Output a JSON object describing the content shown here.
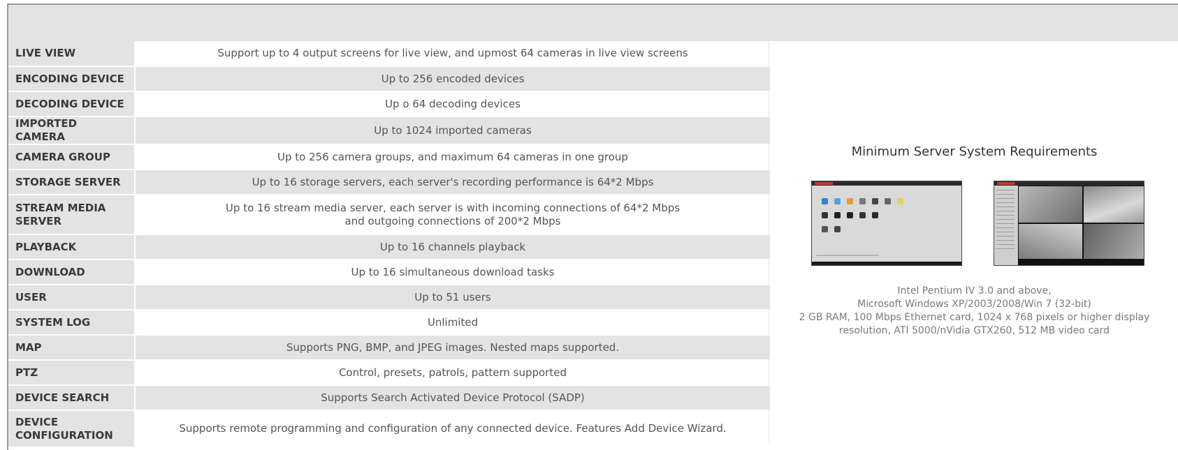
{
  "specs": [
    {
      "label": "LIVE VIEW",
      "value": "Support up to 4 output screens for live view, and upmost 64 cameras in live view screens"
    },
    {
      "label": "ENCODING DEVICE",
      "value": "Up to 256 encoded devices"
    },
    {
      "label": "DECODING DEVICE",
      "value": "Up o 64 decoding devices"
    },
    {
      "label": "IMPORTED CAMERA",
      "value": "Up to 1024 imported cameras"
    },
    {
      "label": "CAMERA GROUP",
      "value": "Up to 256 camera groups, and maximum 64 cameras in one group"
    },
    {
      "label": "STORAGE SERVER",
      "value": "Up to 16 storage servers, each server's recording performance is 64*2 Mbps"
    },
    {
      "label": "STREAM MEDIA SERVER",
      "value_line1": "Up to 16 stream media server, each server is with incoming connections of 64*2 Mbps",
      "value_line2": "and outgoing connections of 200*2 Mbps"
    },
    {
      "label": "PLAYBACK",
      "value": "Up to 16 channels playback"
    },
    {
      "label": "DOWNLOAD",
      "value": "Up to 16 simultaneous download tasks"
    },
    {
      "label": "USER",
      "value": "Up to 51 users"
    },
    {
      "label": "SYSTEM LOG",
      "value": "Unlimited"
    },
    {
      "label": "MAP",
      "value": "Supports PNG, BMP, and JPEG images. Nested maps supported."
    },
    {
      "label": "PTZ",
      "value": "Control, presets, patrols, pattern supported"
    },
    {
      "label": "DEVICE SEARCH",
      "value": "Supports Search Activated Device Protocol (SADP)"
    },
    {
      "label": "DEVICE CONFIGURATION",
      "value": "Supports remote programming and configuration of any connected device. Features Add Device Wizard."
    }
  ],
  "requirements": {
    "title": "Minimum Server System Requirements",
    "lines": [
      "Intel Pentium IV 3.0 and above,",
      "Microsoft Windows XP/2003/2008/Win 7 (32-bit)",
      "2 GB RAM, 100 Mbps Ethernet card, 1024 x 768 pixels or higher display",
      "resolution, ATI 5000/nVidia GTX260, 512 MB video card"
    ]
  },
  "colors": {
    "band": "#e3e3e3",
    "label_text": "#3a3a3a",
    "value_text": "#555555",
    "brand_red": "#c0392b"
  }
}
